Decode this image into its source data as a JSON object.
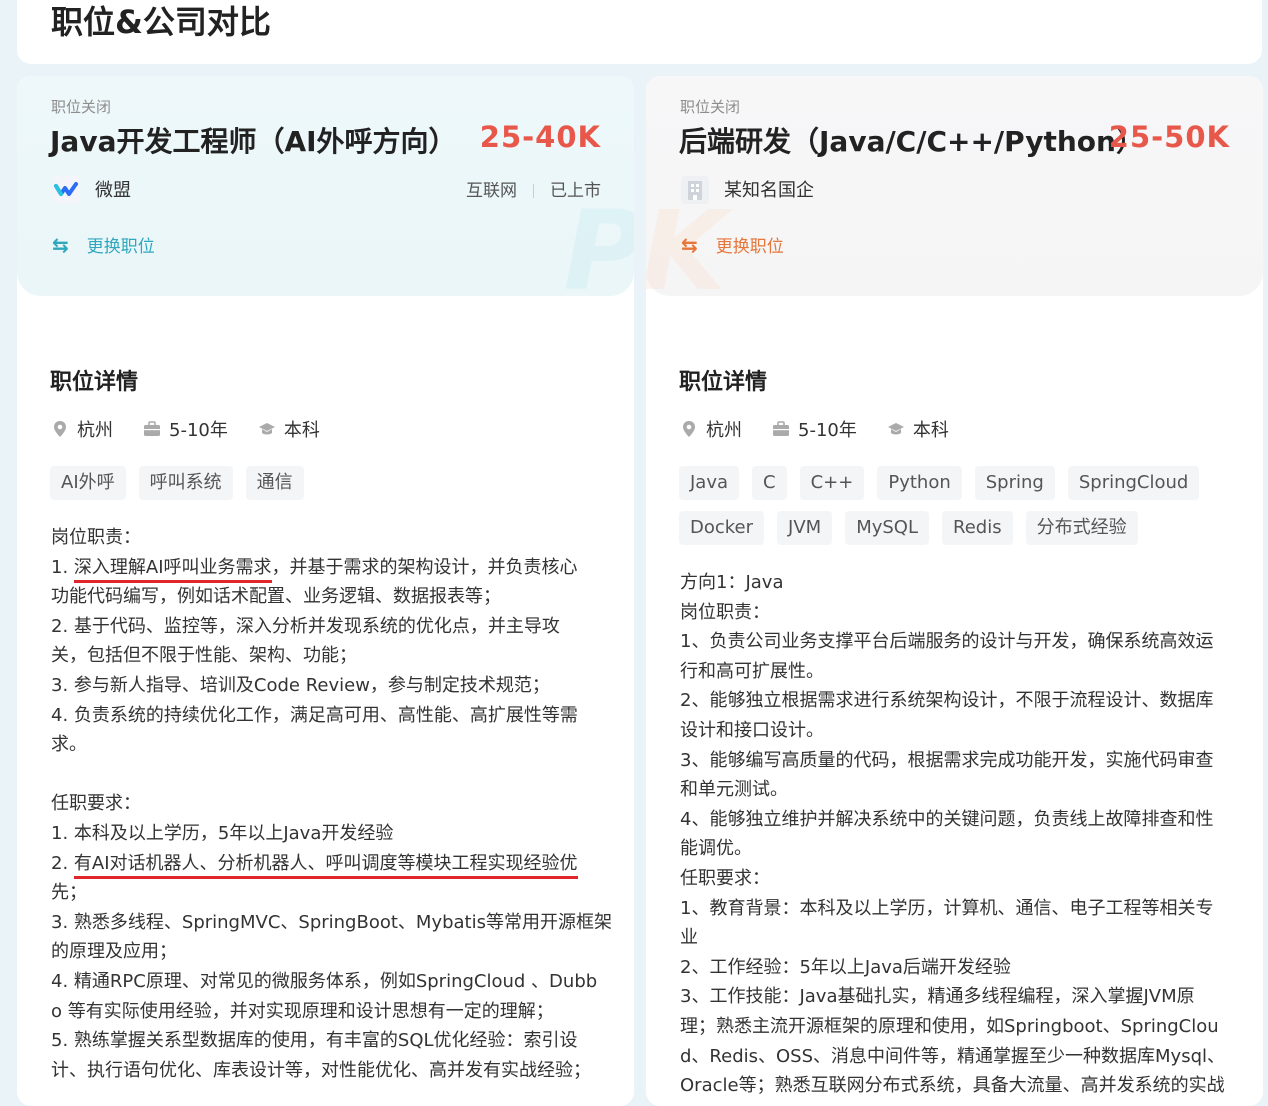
{
  "page": {
    "title": "职位&公司对比"
  },
  "left": {
    "status": "职位关闭",
    "title": "Java开发工程师（AI外呼方向）",
    "salary": "25-40K",
    "company": "微盟",
    "industry": "互联网",
    "stage": "已上市",
    "switch_label": "更换职位",
    "section_title": "职位详情",
    "city": "杭州",
    "experience": "5-10年",
    "education": "本科",
    "tags": [
      "AI外呼",
      "呼叫系统",
      "通信"
    ],
    "desc": {
      "l01": "岗位职责：",
      "l02a": "1. ",
      "l02b": "深入理解AI呼叫业务需求",
      "l02c": "，并基于需求的架构设计，并负责核心",
      "l03": "功能代码编写，例如话术配置、业务逻辑、数据报表等；",
      "l04": "2. 基于代码、监控等，深入分析并发现系统的优化点，并主导攻",
      "l05": "关，包括但不限于性能、架构、功能；",
      "l06": "3. 参与新人指导、培训及Code Review，参与制定技术规范；",
      "l07": "4. 负责系统的持续优化工作，满足高可用、高性能、高扩展性等需",
      "l08": "求。",
      "l09": "任职要求：",
      "l10": "1. 本科及以上学历，5年以上Java开发经验",
      "l11a": "2. ",
      "l11b": "有AI对话机器人、分析机器人、呼叫调度等模块工程实现经验优",
      "l12": "先；",
      "l13": "3. 熟悉多线程、SpringMVC、SpringBoot、Mybatis等常用开源框架",
      "l14": "的原理及应用；",
      "l15": "4. 精通RPC原理、对常见的微服务体系，例如SpringCloud 、Dubb",
      "l16": "o 等有实际使用经验，并对实现原理和设计思想有一定的理解；",
      "l17": "5. 熟练掌握关系型数据库的使用，有丰富的SQL优化经验：索引设",
      "l18": "计、执行语句优化、库表设计等，对性能优化、高并发有实战经验；"
    }
  },
  "right": {
    "status": "职位关闭",
    "title": "后端研发（Java/C/C++/Python）",
    "salary": "25-50K",
    "company": "某知名国企",
    "switch_label": "更换职位",
    "section_title": "职位详情",
    "city": "杭州",
    "experience": "5-10年",
    "education": "本科",
    "tags": [
      "Java",
      "C",
      "C++",
      "Python",
      "Spring",
      "SpringCloud",
      "Docker",
      "JVM",
      "MySQL",
      "Redis",
      "分布式经验"
    ],
    "desc": {
      "l01": "方向1：Java",
      "l02": "岗位职责：",
      "l03": "1、负责公司业务支撑平台后端服务的设计与开发，确保系统高效运",
      "l04": "行和高可扩展性。",
      "l05": "2、能够独立根据需求进行系统架构设计，不限于流程设计、数据库",
      "l06": "设计和接口设计。",
      "l07": "3、能够编写高质量的代码，根据需求完成功能开发，实施代码审查",
      "l08": "和单元测试。",
      "l09": "4、能够独立维护并解决系统中的关键问题，负责线上故障排查和性",
      "l10": "能调优。",
      "l11": "任职要求：",
      "l12": "1、教育背景：本科及以上学历，计算机、通信、电子工程等相关专",
      "l13": "业",
      "l14": "2、工作经验：5年以上Java后端开发经验",
      "l15": "3、工作技能：Java基础扎实，精通多线程编程，深入掌握JVM原",
      "l16": "理；熟悉主流开源框架的原理和使用，如Springboot、SpringClou",
      "l17": "d、Redis、OSS、消息中间件等，精通掌握至少一种数据库Mysql、",
      "l18": "Oracle等；熟悉互联网分布式系统，具备大流量、高并发系统的实战"
    }
  }
}
